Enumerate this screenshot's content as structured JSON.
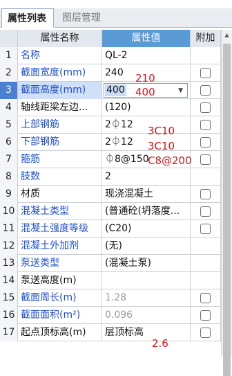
{
  "tabs": {
    "active": "属性列表",
    "inactive": "图层管理"
  },
  "header": {
    "num": "",
    "name": "属性名称",
    "value": "属性值",
    "add": "附加"
  },
  "rows": [
    {
      "num": "1",
      "name": "名称",
      "value": "QL-2",
      "checkbox": false
    },
    {
      "num": "2",
      "name": "截面宽度(mm)",
      "value": "240",
      "checkbox": true
    },
    {
      "num": "3",
      "name": "截面高度(mm)",
      "value": "400",
      "checkbox": true
    },
    {
      "num": "4",
      "name": "轴线距梁左边...",
      "value": "(120)",
      "checkbox": true
    },
    {
      "num": "5",
      "name": "上部钢筋",
      "value": "2⏀12",
      "checkbox": true
    },
    {
      "num": "6",
      "name": "下部钢筋",
      "value": "2⏀12",
      "checkbox": true
    },
    {
      "num": "7",
      "name": "箍筋",
      "value": "⏀8@150",
      "checkbox": true
    },
    {
      "num": "8",
      "name": "肢数",
      "value": "2",
      "checkbox": false
    },
    {
      "num": "9",
      "name": "材质",
      "value": "现浇混凝土",
      "checkbox": true
    },
    {
      "num": "10",
      "name": "混凝土类型",
      "value": "(普通砼(坍落度...",
      "checkbox": true
    },
    {
      "num": "11",
      "name": "混凝土强度等级",
      "value": "(C20)",
      "checkbox": true
    },
    {
      "num": "12",
      "name": "混凝土外加剂",
      "value": "(无)",
      "checkbox": false
    },
    {
      "num": "13",
      "name": "泵送类型",
      "value": "(混凝土泵)",
      "checkbox": false
    },
    {
      "num": "14",
      "name": "泵送高度(m)",
      "value": "",
      "checkbox": false
    },
    {
      "num": "15",
      "name": "截面周长(m)",
      "value": "1.28",
      "checkbox": true
    },
    {
      "num": "16",
      "name": "截面面积(m²)",
      "value": "0.096",
      "checkbox": true
    },
    {
      "num": "17",
      "name": "起点顶标高(m)",
      "value": "层顶标高",
      "checkbox": true
    }
  ],
  "annotations": {
    "width": "210",
    "height": "400",
    "top_rebar": "3C10",
    "bottom_rebar": "3C10",
    "stirrup": "C8@200",
    "elevation": "2.6"
  },
  "colors": {
    "accent": "#5b9bd5",
    "name_blue": "#1f4fd1",
    "annotation_red": "#d4141a"
  }
}
